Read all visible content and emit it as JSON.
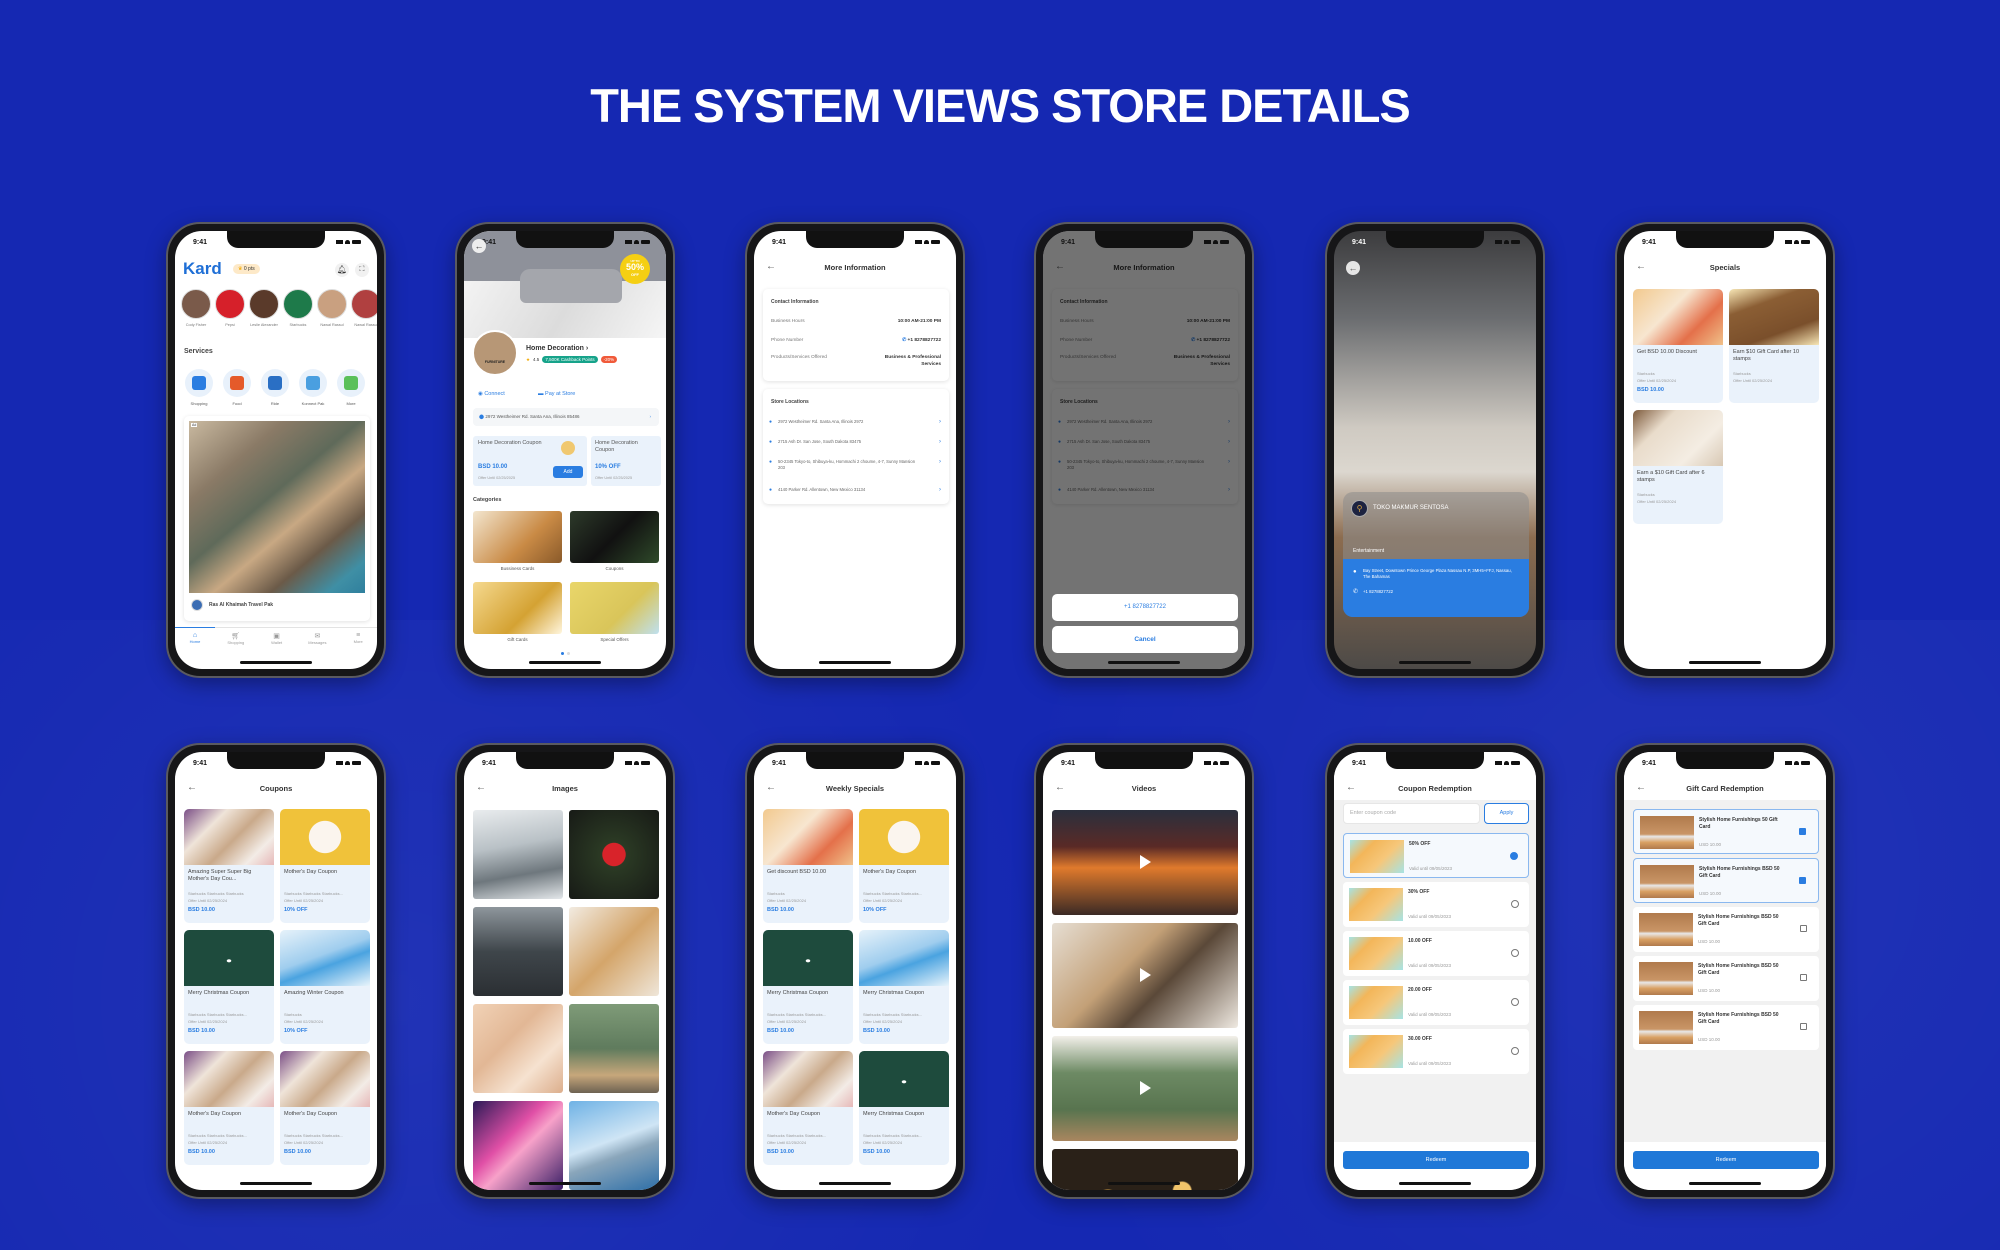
{
  "page_title": "THE SYSTEM VIEWS STORE DETAILS",
  "colors": {
    "background": "#1528b2",
    "accent": "#2a7de1",
    "button": "#1f78d8"
  },
  "status_time": "9:41",
  "home": {
    "logo": "Kard",
    "points": "0 pts",
    "stories": [
      "Cody Fisher",
      "Pepsi",
      "Leslie Alexander",
      "Starbucks",
      "Nawal Rassul",
      "Nawal Rassul"
    ],
    "services_title": "Services",
    "services": [
      "Shopping",
      "Food",
      "Ride",
      "Konnect Pak",
      "More"
    ],
    "ad_label": "Ad",
    "ad_title": "Ras Al Khaimah Travel Pak",
    "nav": [
      "Home",
      "Shopping",
      "Wallet",
      "Messages",
      "More"
    ]
  },
  "store": {
    "banner_badge_top": "UP TO",
    "banner_badge": "50%",
    "banner_badge_bottom": "OFF",
    "logo_text": "FURNITURE",
    "name": "Home Decoration",
    "rating": "4.5",
    "cashback": "7,500K Cashback Points",
    "discount": "-20%",
    "connect": "Connect",
    "pay": "Pay at Store",
    "address": "2972 Westheimer Rd. Santa Ana, Illinois 85486",
    "coupons": [
      {
        "title": "Home Decoration Coupon",
        "price": "BSD 10.00",
        "offer": "Offer Until 02/25/2025",
        "action": "Add"
      },
      {
        "title": "Home Decoration Coupon",
        "price": "10% OFF",
        "offer": "Offer Until 02/25/2025"
      }
    ],
    "categories_title": "Categories",
    "categories": [
      "Bussiness Cards",
      "Coupons",
      "Gift Cards",
      "Special Offers"
    ]
  },
  "more_info": {
    "title": "More Information",
    "contact_title": "Contact Information",
    "hours_label": "Business Hours",
    "hours": "10:00 AM-21:00 PM",
    "phone_label": "Phone Number",
    "phone": "+1 8278827722",
    "products_label": "Products/Services Offered",
    "products": "Business & Professional Services",
    "locations_title": "Store Locations",
    "locations": [
      "2972 Westheimer Rd. Santa Ana, Illinois 2972",
      "2715 Ash Dr. San Jose, South Dakota 83475",
      "50-2345 Tokyo-to, Shibuya-ku, Hommachi 2 choume, 4-7, Sunny Mansion 203",
      "4140 Parker Rd. Allentown, New Mexico 31134"
    ],
    "sheet_call": "+1 8278827722",
    "sheet_cancel": "Cancel"
  },
  "store_card": {
    "name": "TOKO MAKMUR SENTOSA",
    "category": "Entertainment",
    "address": "Bay Street, Downtown Prince George Plaza Nassau N.P, 3MH5+FFJ, Nassau, The Bahamas",
    "phone": "+1 8278827722"
  },
  "specials": {
    "title": "Specials",
    "cards": [
      {
        "image": "voucher",
        "title": "Get BSD 10.00 Discount",
        "store": "Starbucks",
        "offer": "Offer Until 02/25/2024",
        "price": "BSD 10.00"
      },
      {
        "image": "loyalty-brown",
        "title": "Earn $10 Gift Card after 10 stamps",
        "store": "Starbucks",
        "offer": "Offer Until 02/25/2024",
        "price": ""
      },
      {
        "image": "loyalty-beige",
        "title": "Earn a $10 Gift Card after 6 stamps",
        "store": "Starbucks",
        "offer": "Offer Until 02/25/2024",
        "price": ""
      }
    ]
  },
  "coupons": {
    "title": "Coupons",
    "cards": [
      {
        "image": "mothers-day",
        "title": "Amazing Super Super Big Mother's Day Cou...",
        "store": "Starbucks Starbucks Starbucks",
        "offer": "Offer Until 02/25/2024",
        "price": "BSD 10.00"
      },
      {
        "image": "gold-50",
        "title": "Mother's Day Coupon",
        "store": "Starbucks Starbucks Starbucks...",
        "offer": "Offer Until 02/25/2024",
        "price": "10% OFF"
      },
      {
        "image": "amazon-xmas",
        "title": "Merry Christmas Coupon",
        "store": "Starbucks Starbucks Starbucks...",
        "offer": "Offer Until 02/25/2024",
        "price": "BSD 10.00"
      },
      {
        "image": "winter",
        "title": "Amazing Winter Coupon",
        "store": "Starbucks",
        "offer": "Offer Until 02/25/2024",
        "price": "10% OFF"
      },
      {
        "image": "mothers-day",
        "title": "Mother's Day Coupon",
        "store": "Starbucks Starbucks Starbucks...",
        "offer": "Offer Until 02/25/2024",
        "price": "BSD 10.00"
      },
      {
        "image": "mothers-day",
        "title": "Mother's Day Coupon",
        "store": "Starbucks Starbucks Starbucks...",
        "offer": "Offer Until 02/25/2024",
        "price": "BSD 10.00"
      }
    ]
  },
  "images": {
    "title": "Images",
    "items": [
      "snow",
      "red-flower",
      "street",
      "dog",
      "ribbon",
      "kitchen",
      "pink-swirl",
      "pyramid"
    ]
  },
  "weekly": {
    "title": "Weekly Specials",
    "cards": [
      {
        "image": "voucher",
        "title": "Get discount BSD 10.00",
        "store": "Starbucks",
        "offer": "Offer Until 02/25/2024",
        "price": "BSD 10.00"
      },
      {
        "image": "gold-50",
        "title": "Mother's Day Coupon",
        "store": "Starbucks Starbucks Starbucks...",
        "offer": "Offer Until 02/25/2024",
        "price": "10% OFF"
      },
      {
        "image": "amazon-xmas",
        "title": "Merry Christmas Coupon",
        "store": "Starbucks Starbucks Starbucks...",
        "offer": "Offer Until 02/25/2024",
        "price": "BSD 10.00"
      },
      {
        "image": "winter",
        "title": "Merry Christmas Coupon",
        "store": "Starbucks Starbucks Starbucks...",
        "offer": "Offer Until 02/25/2024",
        "price": "BSD 10.00"
      },
      {
        "image": "mothers-day",
        "title": "Mother's Day Coupon",
        "store": "Starbucks Starbucks Starbucks...",
        "offer": "Offer Until 02/25/2024",
        "price": "BSD 10.00"
      },
      {
        "image": "amazon-xmas",
        "title": "Merry Christmas Coupon",
        "store": "Starbucks Starbucks Starbucks...",
        "offer": "Offer Until 02/25/2024",
        "price": "BSD 10.00"
      }
    ]
  },
  "videos": {
    "title": "Videos",
    "items": [
      "tokyo-street",
      "food",
      "green-kitchen",
      "bokeh"
    ]
  },
  "coupon_redemption": {
    "title": "Coupon Redemption",
    "placeholder": "Enter coupon code",
    "apply": "Apply",
    "items": [
      {
        "label": "50% OFF",
        "valid": "Valid until 09/05/2023",
        "selected": true
      },
      {
        "label": "30% OFF",
        "valid": "Valid until 09/05/2023",
        "selected": false
      },
      {
        "label": "10.00 OFF",
        "valid": "Valid until 09/05/2023",
        "selected": false
      },
      {
        "label": "20.00 OFF",
        "valid": "Valid until 09/05/2023",
        "selected": false
      },
      {
        "label": "30.00 OFF",
        "valid": "Valid until 09/05/2023",
        "selected": false
      }
    ],
    "redeem": "Redeem"
  },
  "giftcard_redemption": {
    "title": "Gift Card Redemption",
    "items": [
      {
        "label": "Stylish Home Furnishings 50 Gift Card",
        "price": "USD 10.00",
        "checked": true
      },
      {
        "label": "Stylish Home Furnishings BSD 50 Gift Card",
        "price": "USD 10.00",
        "checked": true
      },
      {
        "label": "Stylish Home Furnishings BSD 50 Gift Card",
        "price": "USD 10.00",
        "checked": false
      },
      {
        "label": "Stylish Home Furnishings BSD 50 Gift Card",
        "price": "USD 10.00",
        "checked": false
      },
      {
        "label": "Stylish Home Furnishings BSD 50 Gift Card",
        "price": "USD 10.00",
        "checked": false
      }
    ],
    "redeem": "Redeem"
  }
}
